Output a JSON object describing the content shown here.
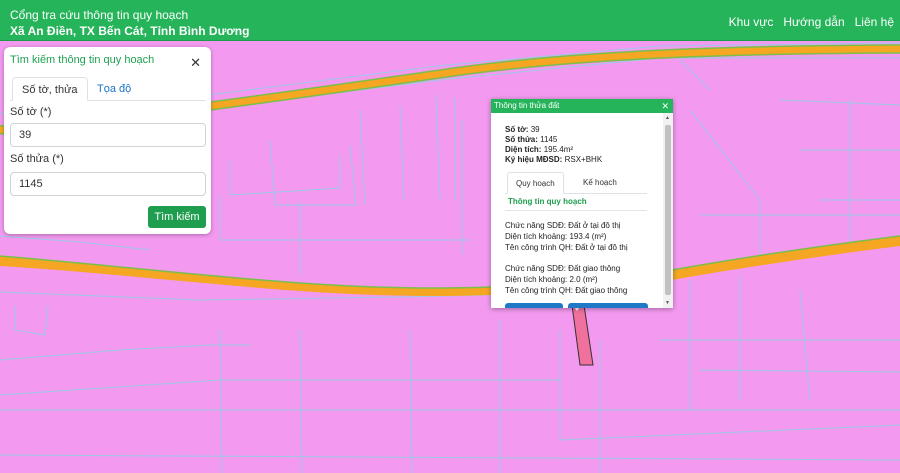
{
  "header": {
    "title": "Cổng tra cứu thông tin quy hoạch",
    "subtitle": "Xã An Điền, TX Bến Cát, Tỉnh Bình Dương",
    "nav": [
      "Khu vực",
      "Hướng dẫn",
      "Liên hệ"
    ]
  },
  "search_panel": {
    "title": "Tìm kiếm thông tin quy hoạch",
    "close_icon": "close-icon",
    "tabs": [
      "Số tờ, thửa",
      "Tọa độ"
    ],
    "sheet_label": "Số tờ (*)",
    "sheet_value": "39",
    "parcel_label": "Số thửa (*)",
    "parcel_value": "1145",
    "search_button": "Tìm kiếm"
  },
  "popup": {
    "title": "Thông tin thửa đất",
    "close_icon": "close-icon",
    "sheet_label": "Số tờ:",
    "sheet_value": "39",
    "parcel_label": "Số thửa:",
    "parcel_value": "1145",
    "area_label": "Diện tích:",
    "area_value": "195.4m²",
    "code_label": "Ký hiệu MĐSD:",
    "code_value": "RSX+BHK",
    "tabs": [
      "Quy hoạch",
      "Kế hoạch"
    ],
    "section_title": "Thông tin quy hoạch",
    "entries": [
      {
        "function": "Chức năng SDĐ: Đất ở tại đô thị",
        "area": "Diện tích khoảng: 193.4 (m²)",
        "name": "Tên công trình QH: Đất ở tại đô thị"
      },
      {
        "function": "Chức năng SDĐ: Đất giao thông",
        "area": "Diện tích khoảng: 2.0 (m²)",
        "name": "Tên công trình QH: Đất giao thông"
      }
    ]
  },
  "colors": {
    "header_green": "#25b45a",
    "land_residential": "#f39af0",
    "road": "#f5a623",
    "parcel_line": "#9ec9e8",
    "selected_parcel": "#f0719e",
    "button_green": "#1e9e4e"
  }
}
